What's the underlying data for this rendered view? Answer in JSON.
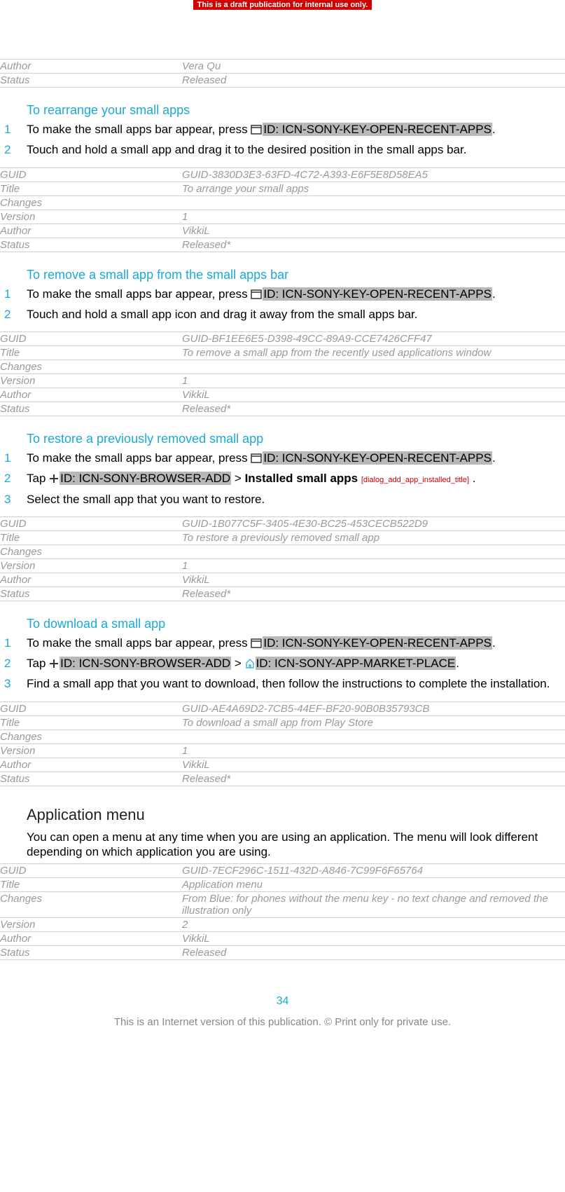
{
  "banner": "This is a draft publication for internal use only.",
  "topMeta": {
    "authorLabel": "Author",
    "authorValue": "Vera Qu",
    "statusLabel": "Status",
    "statusValue": "Released"
  },
  "sections": [
    {
      "heading": "To rearrange your small apps",
      "steps": [
        {
          "pre": "To make the small apps bar appear, press ",
          "icon": "recent-apps",
          "id": "ID: ICN-SONY-KEY-OPEN-RECENT-APPS",
          "post": "."
        },
        {
          "pre": "Touch and hold a small app and drag it to the desired position in the small apps bar."
        }
      ],
      "meta": {
        "guidLabel": "GUID",
        "guid": "GUID-3830D3E3-63FD-4C72-A393-E6F5E8D58EA5",
        "titleLabel": "Title",
        "title": "To arrange your small apps",
        "changesLabel": "Changes",
        "changes": "",
        "versionLabel": "Version",
        "version": "1",
        "authorLabel": "Author",
        "author": "VikkiL",
        "statusLabel": "Status",
        "status": "Released*"
      }
    },
    {
      "heading": "To remove a small app from the small apps bar",
      "steps": [
        {
          "pre": "To make the small apps bar appear, press ",
          "icon": "recent-apps",
          "id": "ID: ICN-SONY-KEY-OPEN-RECENT-APPS",
          "post": "."
        },
        {
          "pre": "Touch and hold a small app icon and drag it away from the small apps bar."
        }
      ],
      "meta": {
        "guidLabel": "GUID",
        "guid": "GUID-BF1EE6E5-D398-49CC-89A9-CCE7426CFF47",
        "titleLabel": "Title",
        "title": "To remove a small app from the recently used applications window",
        "changesLabel": "Changes",
        "changes": "",
        "versionLabel": "Version",
        "version": "1",
        "authorLabel": "Author",
        "author": "VikkiL",
        "statusLabel": "Status",
        "status": "Released*"
      }
    },
    {
      "heading": "To restore a previously removed small app",
      "steps": [
        {
          "pre": "To make the small apps bar appear, press ",
          "icon": "recent-apps",
          "id": "ID: ICN-SONY-KEY-OPEN-RECENT-APPS",
          "post": "."
        },
        {
          "pre": "Tap ",
          "icon": "plus",
          "id": "ID: ICN-SONY-BROWSER-ADD",
          "post2": " > ",
          "boldText": "Installed small apps",
          "afterBold": " ",
          "bracket": "[dialog_add_app_installed_title]",
          "post3": " ."
        },
        {
          "pre": "Select the small app that you want to restore."
        }
      ],
      "meta": {
        "guidLabel": "GUID",
        "guid": "GUID-1B077C5F-3405-4E30-BC25-453CECB522D9",
        "titleLabel": "Title",
        "title": "To restore a previously removed small app",
        "changesLabel": "Changes",
        "changes": "",
        "versionLabel": "Version",
        "version": "1",
        "authorLabel": "Author",
        "author": "VikkiL",
        "statusLabel": "Status",
        "status": "Released*"
      }
    },
    {
      "heading": "To download a small app",
      "steps": [
        {
          "pre": "To make the small apps bar appear, press ",
          "icon": "recent-apps",
          "id": "ID: ICN-SONY-KEY-OPEN-RECENT-APPS",
          "post": "."
        },
        {
          "pre": "Tap ",
          "icon": "plus",
          "id": "ID: ICN-SONY-BROWSER-ADD",
          "post2": " > ",
          "icon2": "market",
          "id2": "ID: ICN-SONY-APP-MARKET-PLACE",
          "post3": "."
        },
        {
          "pre": "Find a small app that you want to download, then follow the instructions to complete the installation."
        }
      ],
      "meta": {
        "guidLabel": "GUID",
        "guid": "GUID-AE4A69D2-7CB5-44EF-BF20-90B0B35793CB",
        "titleLabel": "Title",
        "title": "To download a small app from Play Store",
        "changesLabel": "Changes",
        "changes": "",
        "versionLabel": "Version",
        "version": "1",
        "authorLabel": "Author",
        "author": "VikkiL",
        "statusLabel": "Status",
        "status": "Released*"
      }
    }
  ],
  "appMenu": {
    "heading": "Application menu",
    "para": "You can open a menu at any time when you are using an application. The menu will look different depending on which application you are using.",
    "meta": {
      "guidLabel": "GUID",
      "guid": "GUID-7ECF296C-1511-432D-A846-7C99F6F65764",
      "titleLabel": "Title",
      "title": "Application menu",
      "changesLabel": "Changes",
      "changes": "From Blue: for phones without the menu key - no text change and removed the illustration only",
      "versionLabel": "Version",
      "version": "2",
      "authorLabel": "Author",
      "author": "VikkiL",
      "statusLabel": "Status",
      "status": "Released"
    }
  },
  "pageNumber": "34",
  "footer": "This is an Internet version of this publication. © Print only for private use."
}
